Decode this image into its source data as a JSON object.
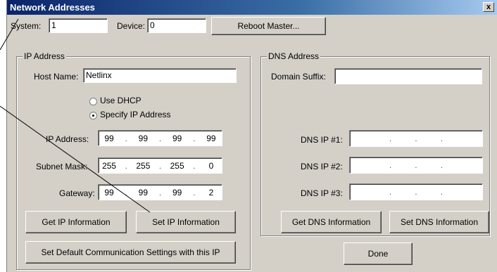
{
  "window": {
    "title": "Network Addresses",
    "close": "x"
  },
  "system": {
    "label": "System:",
    "value": "1"
  },
  "device": {
    "label": "Device:",
    "value": "0"
  },
  "reboot_button": "Reboot Master...",
  "ip_group": {
    "title": "IP Address",
    "host_name_label": "Host Name:",
    "host_name_value": "Netlinx",
    "use_dhcp": "Use DHCP",
    "specify_ip": "Specify IP Address",
    "ip_label": "IP Address:",
    "ip_octets": [
      "99",
      "99",
      "99",
      "99"
    ],
    "subnet_label": "Subnet Mask:",
    "subnet_octets": [
      "255",
      "255",
      "255",
      "0"
    ],
    "gateway_label": "Gateway:",
    "gateway_octets": [
      "99",
      "99",
      "99",
      "2"
    ],
    "get_ip_button": "Get IP Information",
    "set_ip_button": "Set IP Information",
    "set_default_button": "Set Default Communication Settings with this IP"
  },
  "dns_group": {
    "title": "DNS Address",
    "domain_suffix_label": "Domain Suffix:",
    "domain_suffix_value": "",
    "dns1_label": "DNS IP #1:",
    "dns2_label": "DNS IP #2:",
    "dns3_label": "DNS IP #3:",
    "get_dns_button": "Get DNS Information",
    "set_dns_button": "Set DNS Information"
  },
  "done_button": "Done",
  "dot": "."
}
